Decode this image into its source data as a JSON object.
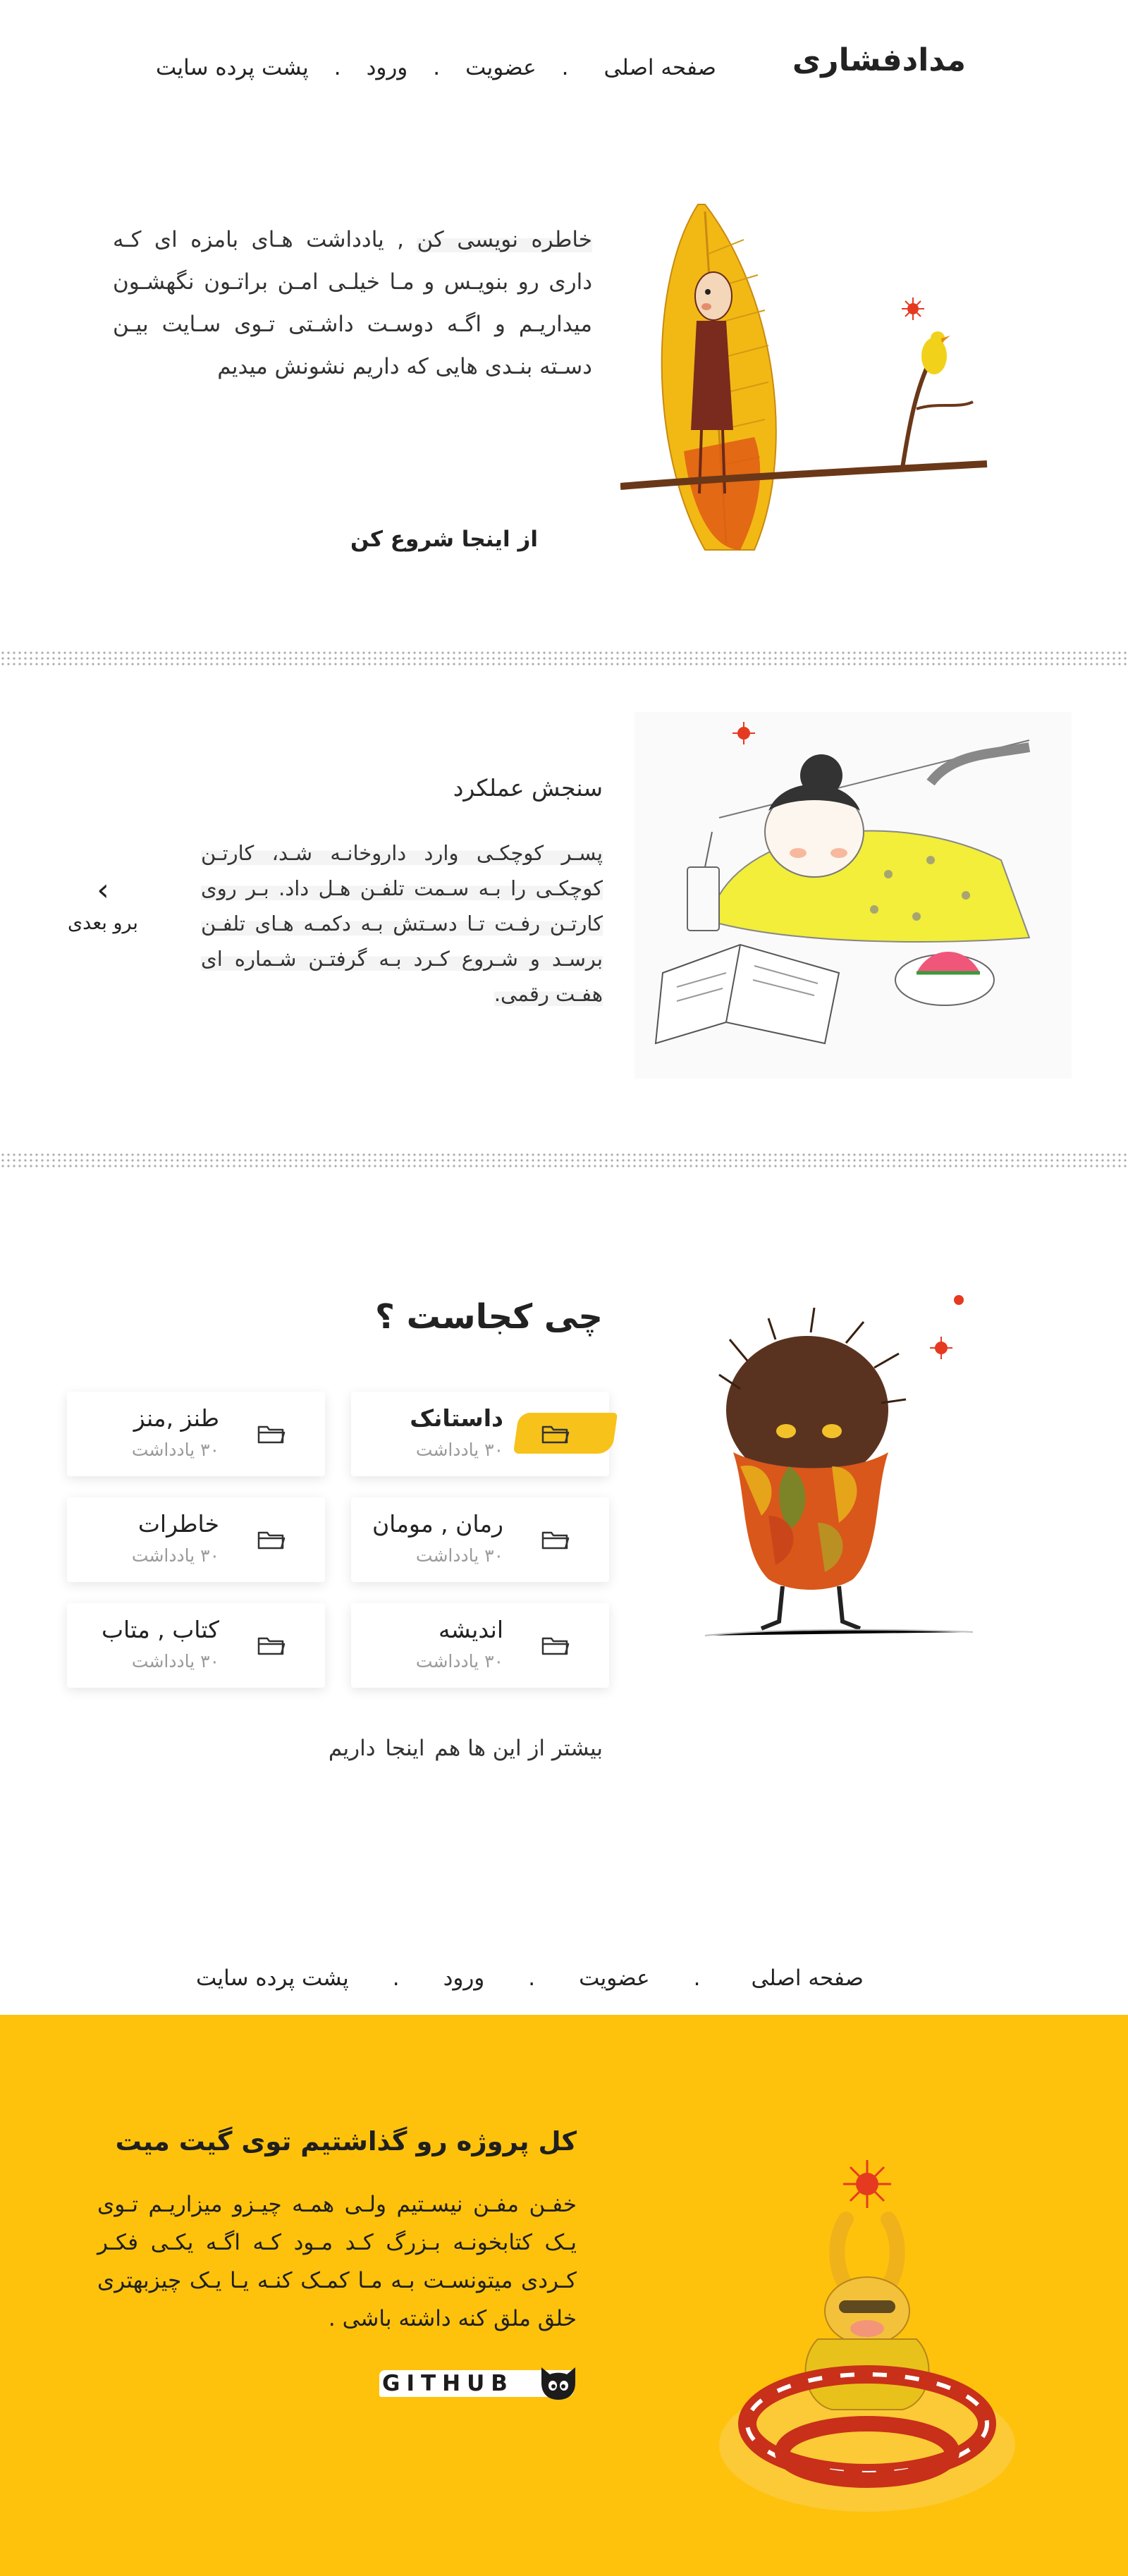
{
  "header": {
    "logo": "مدادفشاری",
    "nav": [
      "صفحه اصلی",
      "عضویت",
      "ورود",
      "پشت پرده سایت"
    ],
    "separator": "."
  },
  "hero": {
    "text_highlight": "خاطره نویسی کن",
    "text_rest": " , یادداشت هـای بامزه ای کـه داری رو بنویـس و مـا خیلـی امـن براتـون نگهشـون میداریـم و اگـه دوسـت داشـتی تـوی سـایت بیـن دسـته بنـدی هایی که داریم نشونش میدیم",
    "cta_label": "از اینجا شروع کن"
  },
  "performance": {
    "title": "سنجش عملکرد",
    "text": "پسـر کوچکـی وارد داروخانـه شـد، کارتـن کوچکـی را بـه سـمت تلفـن هـل داد. بـر روی کارتـن رفـت تـا دسـتش بـه دکمـه هـای تلفـن برسـد و شـروع کـرد بـه گرفتـن شـماره ای هفـت رقمی.",
    "next_label": "برو بعدی",
    "next_icon": "chevron-left-icon"
  },
  "categories": {
    "title": "چی کجاست ؟",
    "items": [
      {
        "name": "داستانک",
        "count": "۳۰ یادداشت",
        "active": true
      },
      {
        "name": "طنز ,منز",
        "count": "۳۰ یادداشت",
        "active": false
      },
      {
        "name": "رمان , مومان",
        "count": "۳۰ یادداشت",
        "active": false
      },
      {
        "name": "خاطرات",
        "count": "۳۰ یادداشت",
        "active": false
      },
      {
        "name": "اندیشه",
        "count": "۳۰ یادداشت",
        "active": false
      },
      {
        "name": "کتاب  ,  متاب",
        "count": "۳۰ یادداشت",
        "active": false
      }
    ],
    "icon": "folder-icon",
    "more_before": "بیشتر از این ها هم ",
    "more_link": "اینجا",
    "more_after": " داریم"
  },
  "footer_nav": [
    "صفحه اصلی",
    "عضویت",
    "ورود",
    "پشت پرده سایت"
  ],
  "github": {
    "title": "کل پروژه رو گذاشتیم توی گیت میت",
    "text": "خفـن مفـن نیسـتیم ولـی همـه چیـزو میزاریـم تـوی یـک کتابخونـه بـزرگ کـد مـود کـه اگـه یکـی فکـر کـردی میتونسـت بـه مـا کمـک کنـه یـا یـک چیزبهتری خلق ملق کنه داشته باشی .",
    "button_label": "GITHUB",
    "button_icon": "github-cat-icon"
  },
  "colors": {
    "accent": "#f7c21a",
    "footer_bg": "#fec20c",
    "text": "#222222",
    "muted": "#9a9a9a"
  }
}
